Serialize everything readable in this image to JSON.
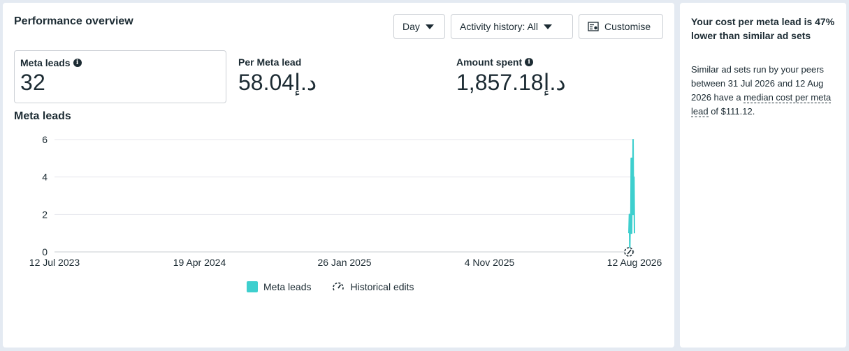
{
  "header": {
    "title": "Performance overview",
    "day_label": "Day",
    "activity_label": "Activity history: All",
    "customise_label": "Customise"
  },
  "metrics": [
    {
      "label": "Meta leads",
      "value": "32",
      "info": true
    },
    {
      "label": "Per Meta lead",
      "value": "58.04د.إ",
      "info": false
    },
    {
      "label": "Amount spent",
      "value": "1,857.18د.إ",
      "info": true
    }
  ],
  "chart_title": "Meta leads",
  "chart_data": {
    "type": "line",
    "title": "Meta leads",
    "xlabel": "",
    "ylabel": "",
    "ylim": [
      0,
      6
    ],
    "yticks": [
      0,
      2,
      4,
      6
    ],
    "xlim": [
      "2023-07-12",
      "2026-08-12"
    ],
    "xticks": [
      "12 Jul 2023",
      "19 Apr 2024",
      "26 Jan 2025",
      "4 Nov 2025",
      "12 Aug 2026"
    ],
    "grid": true,
    "legend_position": "bottom",
    "series": [
      {
        "name": "Meta leads",
        "color": "#3ecfce",
        "x": [
          "2026-07-31",
          "2026-08-01",
          "2026-08-02",
          "2026-08-03",
          "2026-08-04",
          "2026-08-05",
          "2026-08-06",
          "2026-08-07",
          "2026-08-08",
          "2026-08-09",
          "2026-08-10",
          "2026-08-11",
          "2026-08-12"
        ],
        "y": [
          1,
          2,
          0,
          2,
          1,
          5,
          1,
          5,
          2,
          6,
          2,
          4,
          1
        ]
      }
    ],
    "edit_markers": [
      "2026-08-12"
    ]
  },
  "legend": {
    "meta_leads": "Meta leads",
    "historical_edits": "Historical edits"
  },
  "side": {
    "title": "Your cost per meta lead is 47% lower than similar ad sets",
    "body_before": "Similar ad sets run by your peers between 31 Jul 2026 and 12 Aug 2026 have a ",
    "body_link": "median cost per meta lead",
    "body_after": " of $111.12."
  }
}
